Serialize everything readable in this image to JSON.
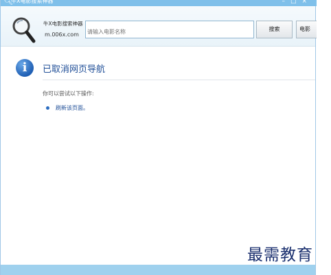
{
  "window": {
    "title": "牛X电影搜索神器",
    "icon": "search-icon",
    "controls": [
      "minimize",
      "maximize",
      "close"
    ]
  },
  "toolbar": {
    "logo_icon": "magnifier-icon",
    "app_name": "牛X电影搜索神器",
    "app_url": "m.006x.com",
    "search_placeholder": "请输入电影名称",
    "search_label": "搜索",
    "movie_label": "电影"
  },
  "page": {
    "info_icon": "info-icon",
    "heading": "已取消网页导航",
    "hint": "你可以尝试以下操作:",
    "action_link": "刷新该页面。"
  },
  "watermark": "最需教育",
  "colors": {
    "titlebar": "#7fc0ea",
    "heading": "#1f4e97",
    "statusbar": "#9fd1ee"
  }
}
